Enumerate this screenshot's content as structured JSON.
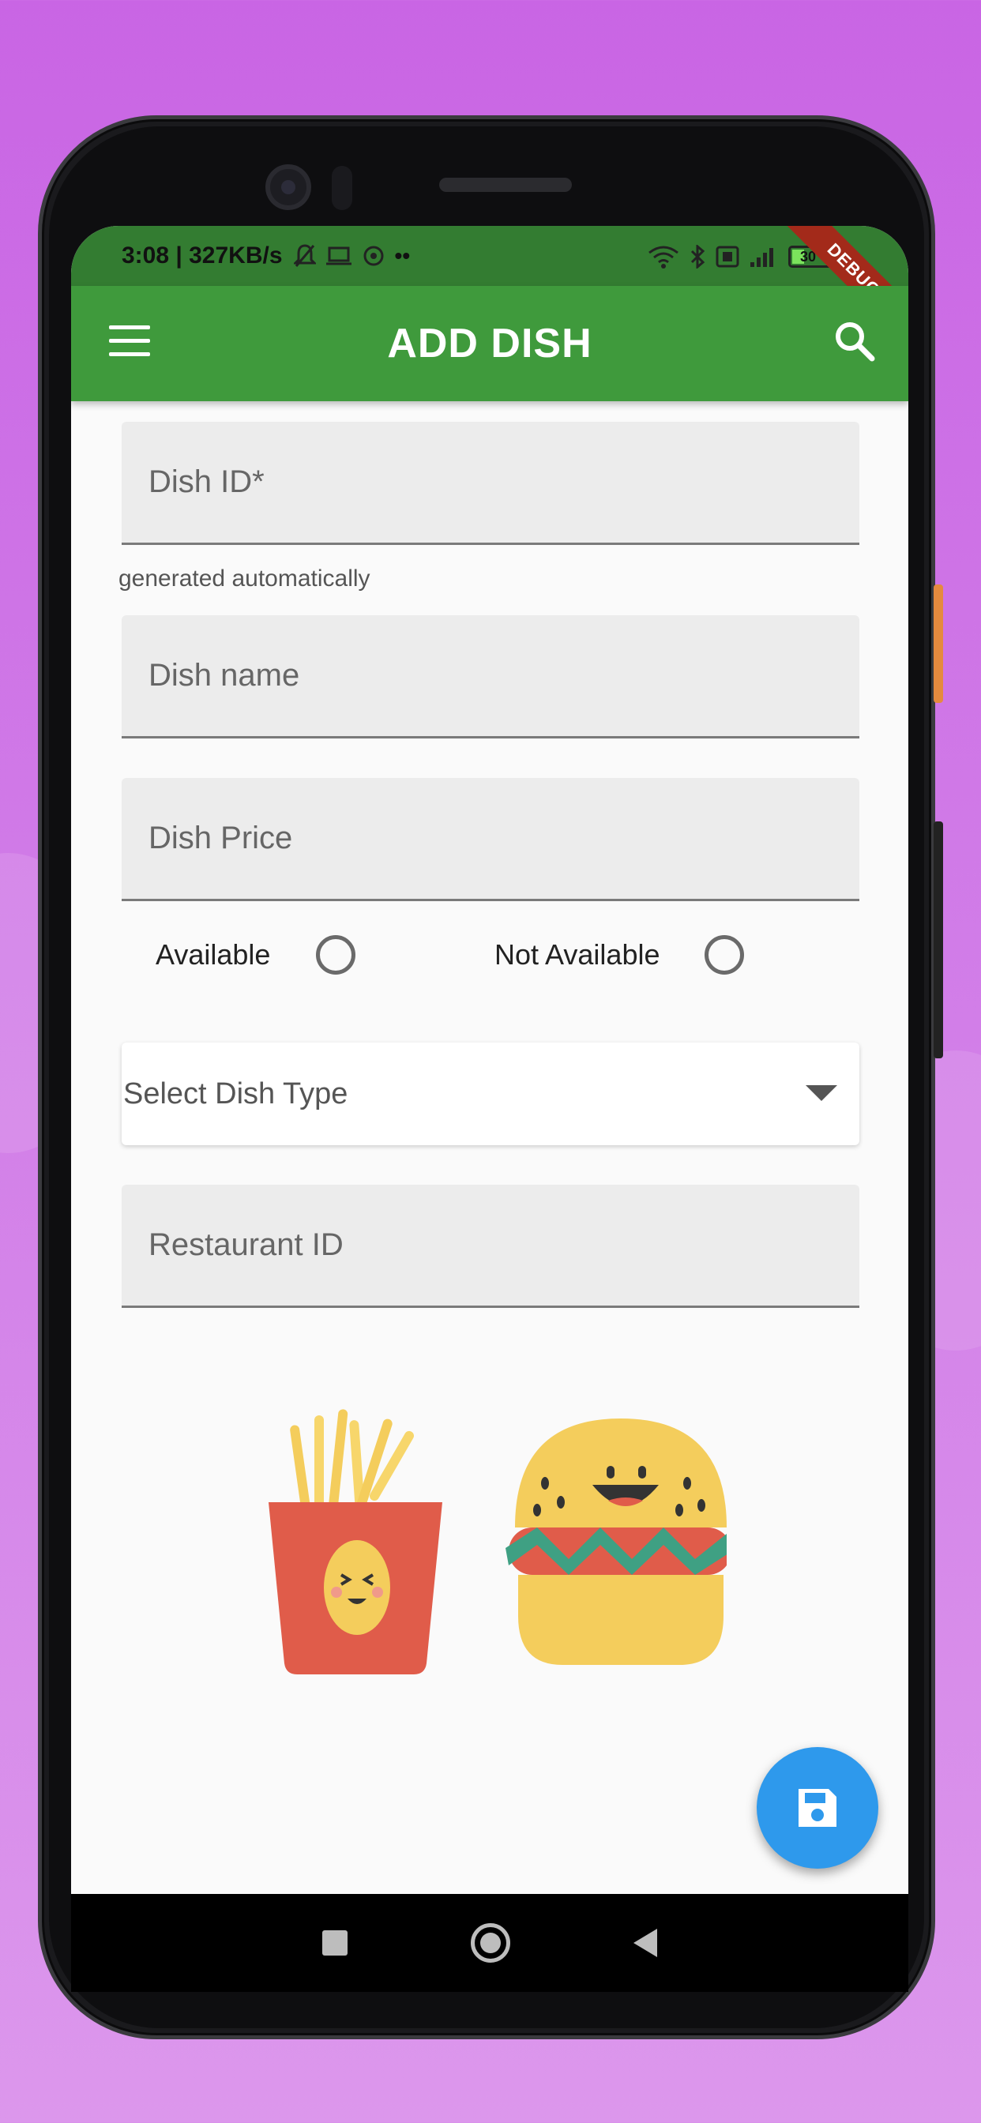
{
  "status_bar": {
    "time_and_speed": "3:08 | 327KB/s",
    "battery": "30"
  },
  "debug_banner": "DEBUG",
  "app_bar": {
    "title": "ADD DISH",
    "menu_icon": "menu-icon",
    "search_icon": "search-icon"
  },
  "form": {
    "dish_id": {
      "placeholder": "Dish ID*",
      "helper": "generated automatically"
    },
    "dish_name": {
      "placeholder": "Dish name"
    },
    "dish_price": {
      "placeholder": "Dish Price"
    },
    "availability": {
      "available_label": "Available",
      "not_available_label": "Not Available"
    },
    "dish_type": {
      "placeholder": "Select Dish Type"
    },
    "restaurant_id": {
      "placeholder": "Restaurant ID"
    }
  },
  "fab": {
    "icon": "save-icon"
  },
  "nav": {
    "recents": "square-icon",
    "home": "circle-icon",
    "back": "triangle-back-icon"
  },
  "colors": {
    "app_bar": "#3f9a3c",
    "status_bar": "#337c31",
    "fab": "#2e99ec",
    "background": "#c965e4"
  }
}
